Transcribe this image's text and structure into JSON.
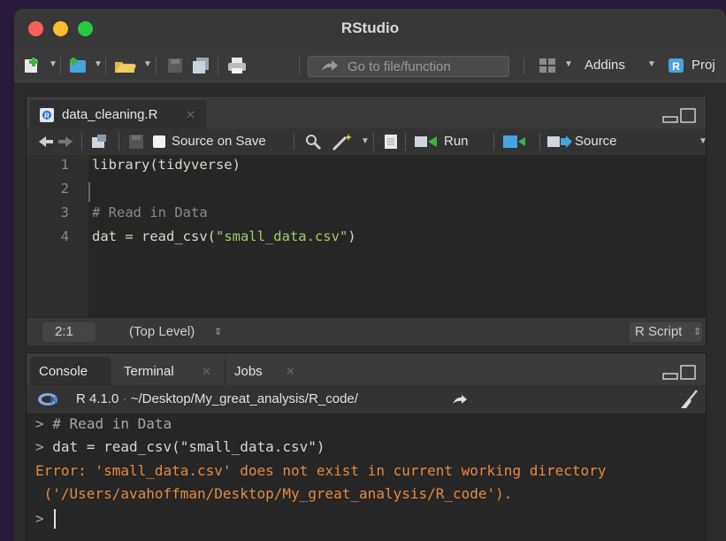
{
  "window": {
    "title": "RStudio"
  },
  "toolbar": {
    "goto_placeholder": "Go to file/function",
    "addins_label": "Addins",
    "project_label": "Proj"
  },
  "editor": {
    "tab_label": "data_cleaning.R",
    "source_on_save_label": "Source on Save",
    "run_label": "Run",
    "source_label": "Source",
    "lines": [
      {
        "num": "1",
        "text": "library(tidyverse)"
      },
      {
        "num": "2",
        "text": ""
      },
      {
        "num": "3",
        "text": "# Read in Data"
      },
      {
        "num": "4",
        "text_prefix": "dat = read_csv(",
        "text_string": "\"small_data.csv\"",
        "text_suffix": ")"
      }
    ],
    "status": {
      "position": "2:1",
      "scope": "(Top Level)",
      "file_type": "R Script"
    }
  },
  "console": {
    "tabs": [
      {
        "label": "Console"
      },
      {
        "label": "Terminal"
      },
      {
        "label": "Jobs"
      }
    ],
    "r_version": "R 4.1.0",
    "working_dir": "~/Desktop/My_great_analysis/R_code/",
    "lines": [
      {
        "kind": "cmd",
        "prompt": ">",
        "text": "# Read in Data"
      },
      {
        "kind": "cmd",
        "prompt": ">",
        "text": "dat = read_csv(\"small_data.csv\")"
      },
      {
        "kind": "err",
        "text": "Error: 'small_data.csv' does not exist in current working directory"
      },
      {
        "kind": "err",
        "text": " ('/Users/avahoffman/Desktop/My_great_analysis/R_code')."
      }
    ],
    "final_prompt": ">"
  },
  "colors": {
    "error": "#e58a3f",
    "string": "#a4c96a",
    "comment": "#8a8a8a"
  }
}
